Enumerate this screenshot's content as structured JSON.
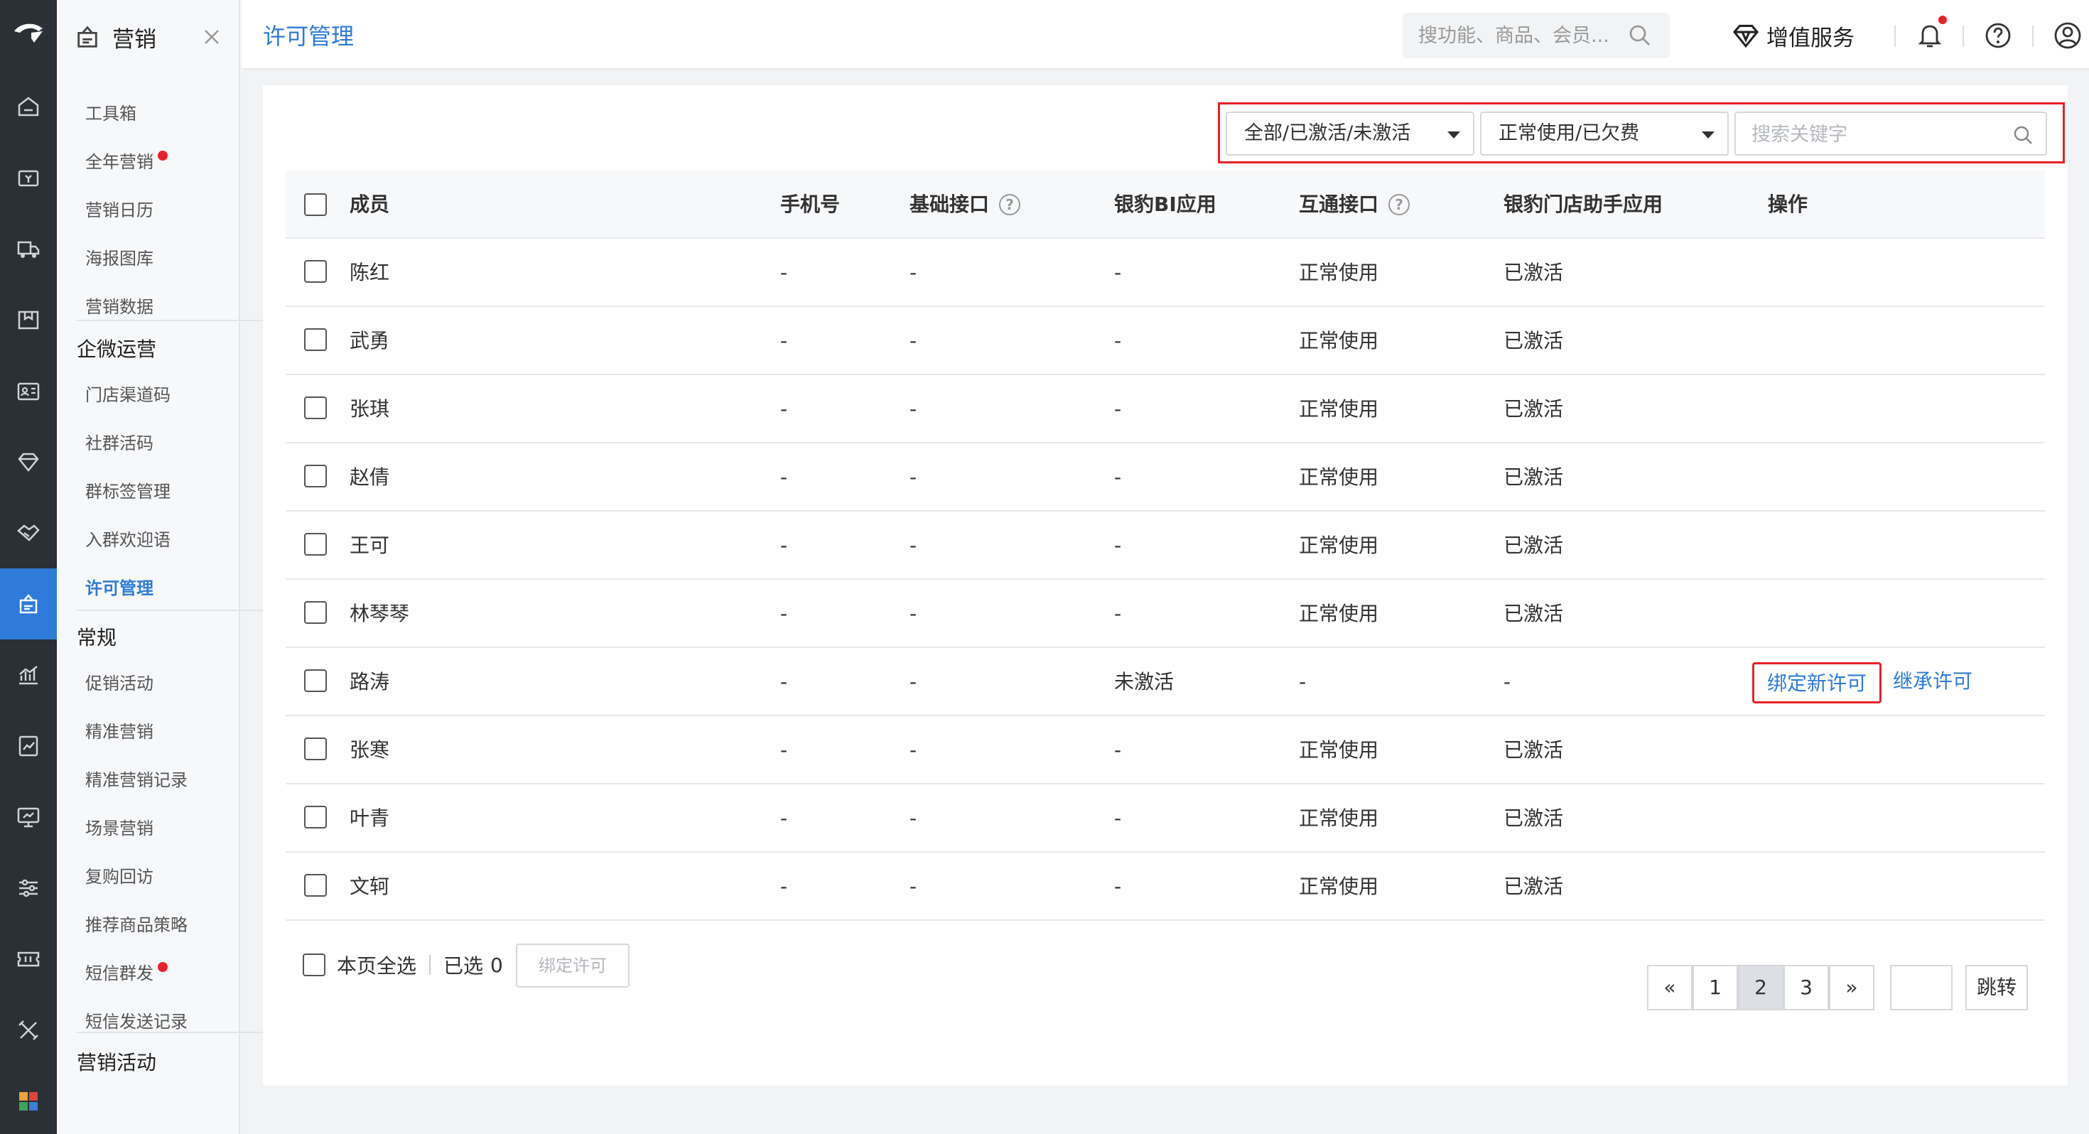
{
  "sidebar": {
    "title": "营销",
    "items_top": [
      {
        "label": "工具箱",
        "dot": false
      },
      {
        "label": "全年营销",
        "dot": true
      },
      {
        "label": "营销日历",
        "dot": false
      },
      {
        "label": "海报图库",
        "dot": false
      },
      {
        "label": "营销数据",
        "dot": false
      }
    ],
    "group1": "企微运营",
    "items_wecom": [
      {
        "label": "门店渠道码",
        "active": false
      },
      {
        "label": "社群活码",
        "active": false
      },
      {
        "label": "群标签管理",
        "active": false
      },
      {
        "label": "入群欢迎语",
        "active": false
      },
      {
        "label": "许可管理",
        "active": true
      }
    ],
    "group2": "常规",
    "items_regular": [
      {
        "label": "促销活动",
        "dot": false
      },
      {
        "label": "精准营销",
        "dot": false
      },
      {
        "label": "精准营销记录",
        "dot": false
      },
      {
        "label": "场景营销",
        "dot": false
      },
      {
        "label": "复购回访",
        "dot": false
      },
      {
        "label": "推荐商品策略",
        "dot": false
      },
      {
        "label": "短信群发",
        "dot": true
      },
      {
        "label": "短信发送记录",
        "dot": false
      }
    ],
    "group3": "营销活动"
  },
  "header": {
    "page_title": "许可管理",
    "search_placeholder": "搜功能、商品、会员...",
    "value_service": "增值服务"
  },
  "filters": {
    "activation": "全部/已激活/未激活",
    "usage": "正常使用/已欠费",
    "keyword_placeholder": "搜索关键字"
  },
  "table": {
    "columns": {
      "member": "成员",
      "phone": "手机号",
      "basic_api": "基础接口",
      "bi_app": "银豹BI应用",
      "interop_api": "互通接口",
      "store_app": "银豹门店助手应用",
      "ops": "操作"
    },
    "rows": [
      {
        "member": "陈红",
        "phone": "-",
        "basic_api": "-",
        "bi_app": "-",
        "interop_api": "正常使用",
        "store_app": "已激活",
        "op1": "",
        "op2": ""
      },
      {
        "member": "武勇",
        "phone": "-",
        "basic_api": "-",
        "bi_app": "-",
        "interop_api": "正常使用",
        "store_app": "已激活",
        "op1": "",
        "op2": ""
      },
      {
        "member": "张琪",
        "phone": "-",
        "basic_api": "-",
        "bi_app": "-",
        "interop_api": "正常使用",
        "store_app": "已激活",
        "op1": "",
        "op2": ""
      },
      {
        "member": "赵倩",
        "phone": "-",
        "basic_api": "-",
        "bi_app": "-",
        "interop_api": "正常使用",
        "store_app": "已激活",
        "op1": "",
        "op2": ""
      },
      {
        "member": "王可",
        "phone": "-",
        "basic_api": "-",
        "bi_app": "-",
        "interop_api": "正常使用",
        "store_app": "已激活",
        "op1": "",
        "op2": ""
      },
      {
        "member": "林琴琴",
        "phone": "-",
        "basic_api": "-",
        "bi_app": "-",
        "interop_api": "正常使用",
        "store_app": "已激活",
        "op1": "",
        "op2": ""
      },
      {
        "member": "路涛",
        "phone": "-",
        "basic_api": "-",
        "bi_app": "未激活",
        "interop_api": "-",
        "store_app": "-",
        "op1": "绑定新许可",
        "op2": "继承许可"
      },
      {
        "member": "张寒",
        "phone": "-",
        "basic_api": "-",
        "bi_app": "-",
        "interop_api": "正常使用",
        "store_app": "已激活",
        "op1": "",
        "op2": ""
      },
      {
        "member": "叶青",
        "phone": "-",
        "basic_api": "-",
        "bi_app": "-",
        "interop_api": "正常使用",
        "store_app": "已激活",
        "op1": "",
        "op2": ""
      },
      {
        "member": "文轲",
        "phone": "-",
        "basic_api": "-",
        "bi_app": "-",
        "interop_api": "正常使用",
        "store_app": "已激活",
        "op1": "",
        "op2": ""
      }
    ]
  },
  "footer": {
    "select_page": "本页全选",
    "selected_label": "已选",
    "selected_count": "0",
    "bind_button": "绑定许可",
    "pagination": {
      "prev": "«",
      "pages": [
        "1",
        "2",
        "3"
      ],
      "current": "2",
      "next": "»",
      "jump": "跳转"
    }
  },
  "colors": {
    "accent": "#2f7bd9",
    "highlight": "#e8202b",
    "rail": "#2b2f36"
  }
}
